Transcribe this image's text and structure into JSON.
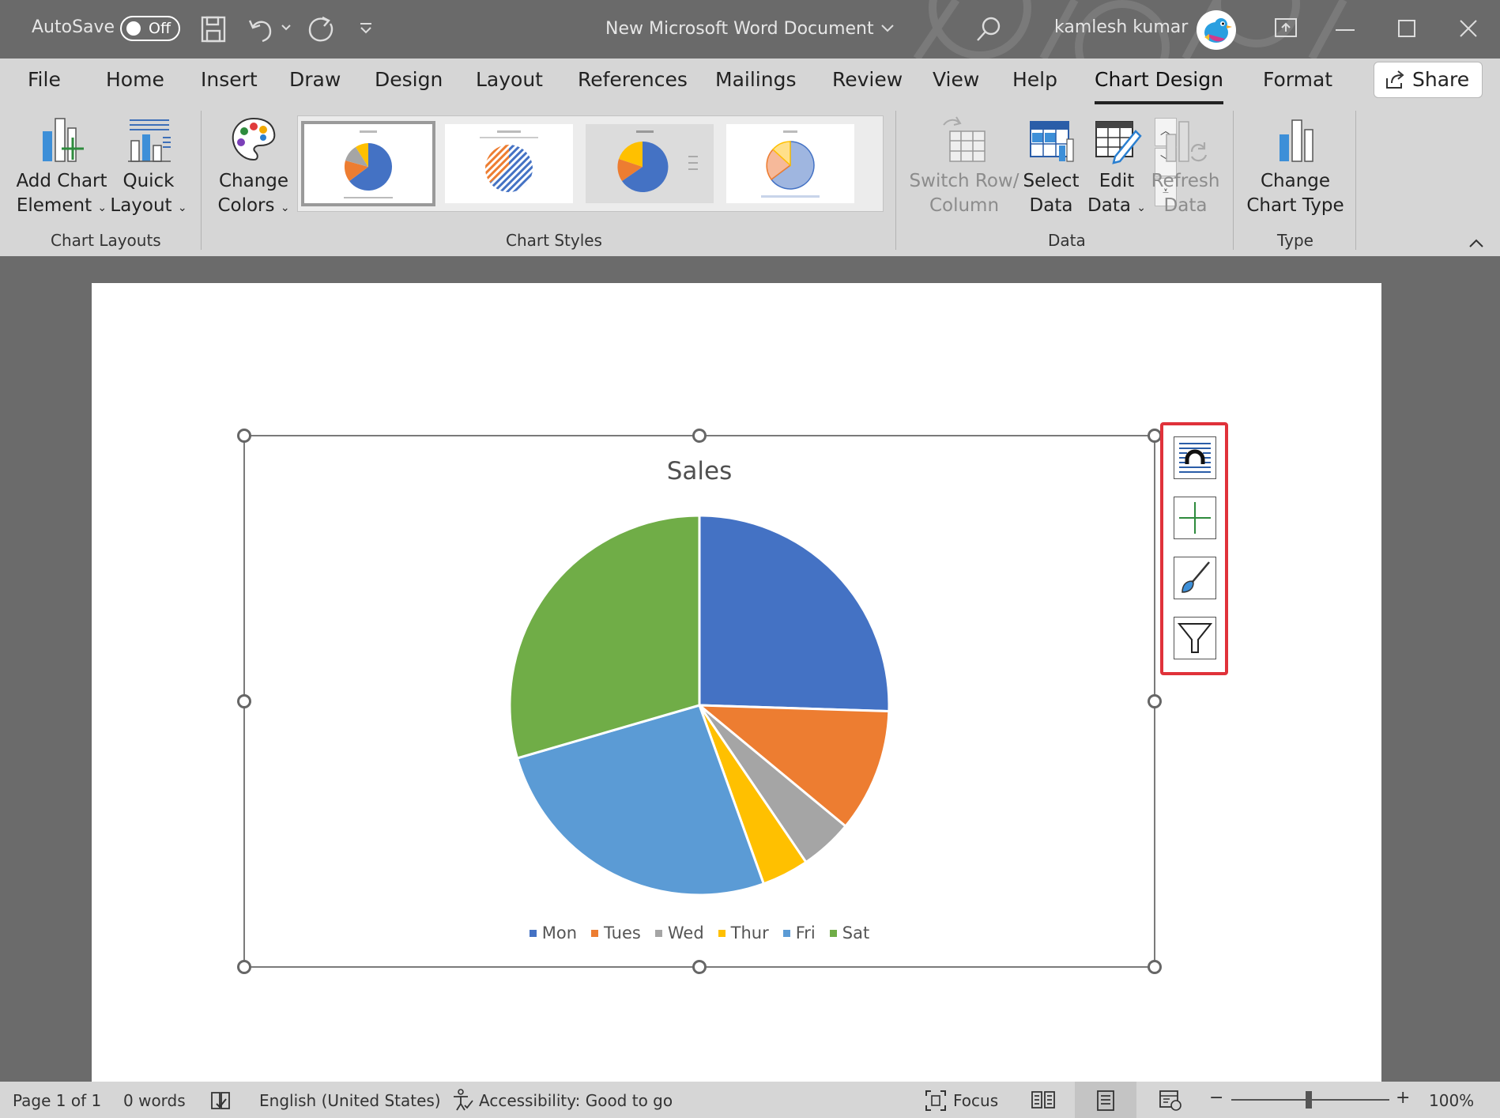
{
  "titlebar": {
    "autosave_label": "AutoSave",
    "autosave_state": "Off",
    "document_title": "New Microsoft Word Document",
    "user_name": "kamlesh kumar"
  },
  "tabs": [
    "File",
    "Home",
    "Insert",
    "Draw",
    "Design",
    "Layout",
    "References",
    "Mailings",
    "Review",
    "View",
    "Help",
    "Chart Design",
    "Format"
  ],
  "active_tab": "Chart Design",
  "share_label": "Share",
  "ribbon": {
    "add_chart_element": [
      "Add Chart",
      "Element"
    ],
    "quick_layout": [
      "Quick",
      "Layout"
    ],
    "change_colors": [
      "Change",
      "Colors"
    ],
    "switch_row_column": [
      "Switch Row/",
      "Column"
    ],
    "select_data": [
      "Select",
      "Data"
    ],
    "edit_data": [
      "Edit",
      "Data"
    ],
    "refresh_data": [
      "Refresh",
      "Data"
    ],
    "change_chart_type": [
      "Change",
      "Chart Type"
    ],
    "groups": {
      "chart_layouts": "Chart Layouts",
      "chart_styles": "Chart Styles",
      "data": "Data",
      "type": "Type"
    }
  },
  "chart_data": {
    "type": "pie",
    "title": "Sales",
    "categories": [
      "Mon",
      "Tues",
      "Wed",
      "Thur",
      "Fri",
      "Sat"
    ],
    "values": [
      25.5,
      10.5,
      4.5,
      4,
      26,
      29.5
    ],
    "colors": [
      "#4472C4",
      "#ED7D31",
      "#A5A5A5",
      "#FFC000",
      "#5B9BD5",
      "#70AD47"
    ],
    "legend_position": "bottom"
  },
  "status": {
    "page": "Page 1 of 1",
    "words": "0 words",
    "language": "English (United States)",
    "accessibility": "Accessibility: Good to go",
    "focus": "Focus",
    "zoom": "100%"
  }
}
